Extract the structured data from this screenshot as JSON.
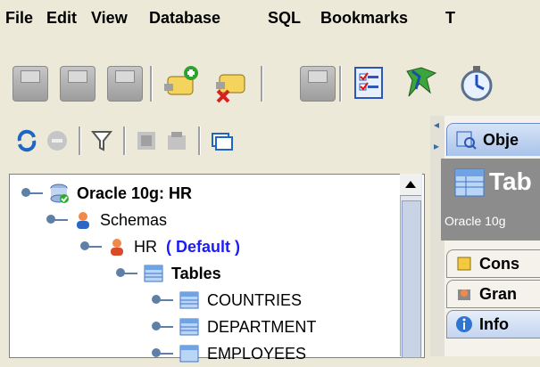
{
  "menu": {
    "items": [
      {
        "label": "File"
      },
      {
        "label": "Edit"
      },
      {
        "label": "View"
      },
      {
        "label": "Database"
      },
      {
        "label": "SQL"
      },
      {
        "label": "Bookmarks"
      },
      {
        "label": "T"
      }
    ]
  },
  "toolbar": {
    "icons": [
      "disk-icon-1",
      "disk-icon-2",
      "disk-icon-3",
      "connect-icon",
      "disconnect-icon",
      "stop-icon",
      "checklist-icon",
      "bookmark-icon",
      "stopwatch-icon"
    ]
  },
  "tree_toolbar": {
    "icons": [
      "refresh-icon",
      "stop-icon",
      "filter-icon",
      "collapse-icon",
      "expand-icon",
      "new-window-icon"
    ]
  },
  "tree": {
    "connection": "Oracle 10g: HR",
    "schemas": "Schemas",
    "schema": "HR",
    "default": "( Default )",
    "tables": "Tables",
    "items": [
      "COUNTRIES",
      "DEPARTMENT",
      "EMPLOYEES"
    ]
  },
  "right": {
    "object_tab": "Obje",
    "title": "Tab",
    "subtitle": "Oracle 10g",
    "tabs": [
      "Cons",
      "Gran",
      "Info"
    ]
  },
  "colors": {
    "menu_bg": "#ece9d8",
    "tree_bg": "#ffffff",
    "default_blue": "#1b1bff"
  }
}
